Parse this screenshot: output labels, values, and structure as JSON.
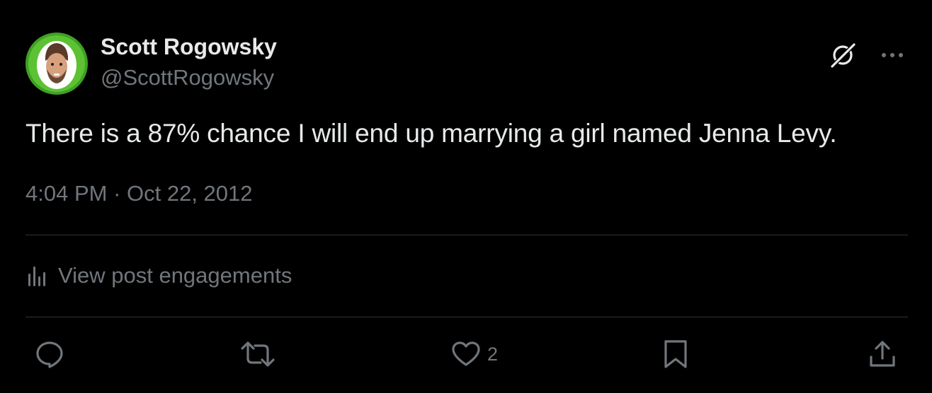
{
  "tweet": {
    "author": {
      "display_name": "Scott Rogowsky",
      "handle": "@ScottRogowsky"
    },
    "text": "There is a 87% chance I will end up marrying a girl named Jenna Levy.",
    "time": "4:04 PM",
    "separator": " · ",
    "date": "Oct 22, 2012",
    "engagements_label": "View post engagements",
    "actions": {
      "reply_icon": "reply-icon",
      "retweet_icon": "retweet-icon",
      "like_icon": "heart-icon",
      "like_count": "2",
      "bookmark_icon": "bookmark-icon",
      "share_icon": "share-icon"
    }
  },
  "colors": {
    "background": "#000000",
    "primary_text": "#e7e9ea",
    "secondary_text": "#71767b",
    "divider": "#2f3336",
    "avatar_ring": "#4caf2a"
  }
}
